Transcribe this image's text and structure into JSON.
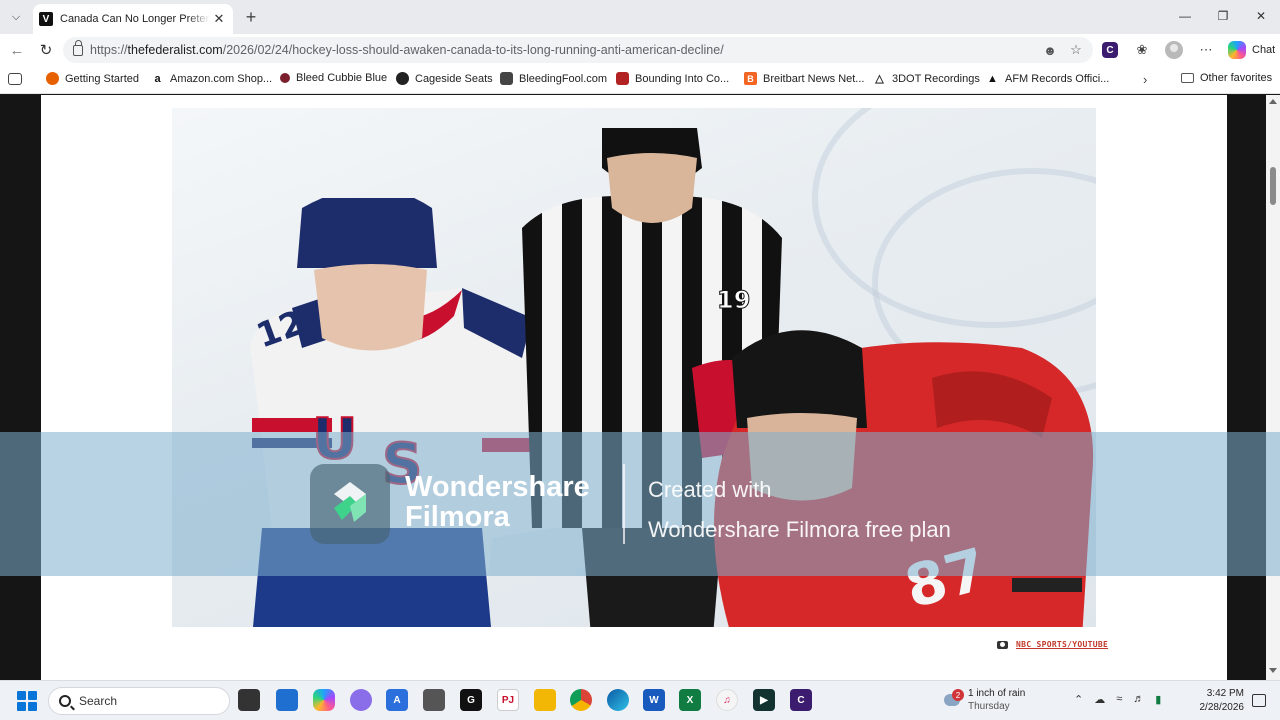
{
  "browser": {
    "tab": {
      "title": "Canada Can No Longer Pretend To",
      "favicon": "V"
    },
    "address": {
      "scheme": "https://",
      "host": "thefederalist.com",
      "path": "/2026/02/24/hockey-loss-should-awaken-canada-to-its-long-running-anti-american-decline/"
    },
    "extension_letter": "C",
    "chat_label": "Chat"
  },
  "favorites": {
    "items": [
      {
        "label": "Getting Started",
        "icon": "firefox-icon",
        "color": "#e66000"
      },
      {
        "label": "Amazon.com Shop...",
        "icon": "amazon-icon",
        "color": "#111111"
      },
      {
        "label": "Bleed Cubbie Blue",
        "icon": "bleed-cubbie-blue-icon",
        "color": "#7a1f2b"
      },
      {
        "label": "Cageside Seats",
        "icon": "cageside-seats-icon",
        "color": "#222222"
      },
      {
        "label": "BleedingFool.com",
        "icon": "bleedingfool-icon",
        "color": "#333333"
      },
      {
        "label": "Bounding Into Co...",
        "icon": "bounding-into-comics-icon",
        "color": "#b22222"
      },
      {
        "label": "Breitbart News Net...",
        "icon": "breitbart-icon",
        "color": "#f26522"
      },
      {
        "label": "3DOT Recordings",
        "icon": "3dot-icon",
        "color": "#555555"
      },
      {
        "label": "AFM Records Offici...",
        "icon": "afm-records-icon",
        "color": "#111111"
      }
    ],
    "other_label": "Other favorites"
  },
  "article": {
    "photo_credit": "NBC SPORTS/YOUTUBE"
  },
  "watermark": {
    "brand_line1": "Wondershare",
    "brand_line2": "Filmora",
    "text_line1": "Created with",
    "text_line2": "Wondershare Filmora free plan"
  },
  "taskbar": {
    "search_label": "Search",
    "weather": {
      "line1": "1 inch of rain",
      "line2": "Thursday",
      "badge": "2"
    },
    "time": "3:42 PM",
    "date": "2/28/2026"
  }
}
